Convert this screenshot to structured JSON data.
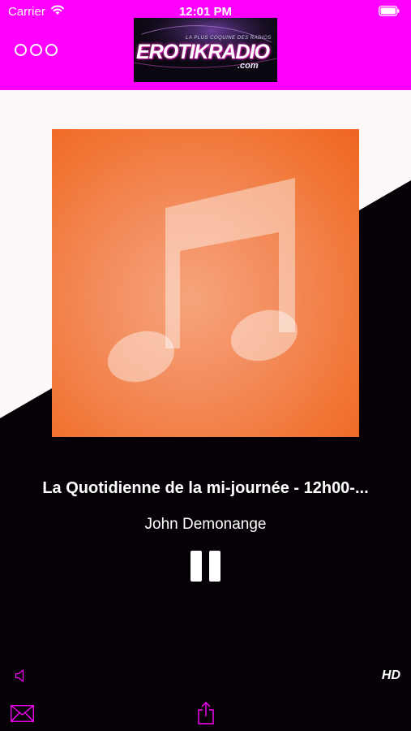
{
  "status_bar": {
    "carrier": "Carrier",
    "time": "12:01 PM"
  },
  "header": {
    "background": "#ff00ff",
    "logo": {
      "tagline": "LA PLUS COQUINE DES RADIOS",
      "word": "EROTIKRADIO",
      "sub": ".com"
    }
  },
  "player": {
    "title": "La Quotidienne de la mi-journée - 12h00-...",
    "artist": "John Demonange",
    "quality_badge": "HD"
  },
  "colors": {
    "accent": "#ff00ff",
    "background_dark": "#060106",
    "background_light": "#fff8f8",
    "artwork": "#f1722f"
  },
  "icons": [
    "wifi-icon",
    "battery-icon",
    "menu-icon",
    "music-note-icon",
    "pause-icon",
    "volume-icon",
    "mail-icon",
    "share-icon"
  ]
}
